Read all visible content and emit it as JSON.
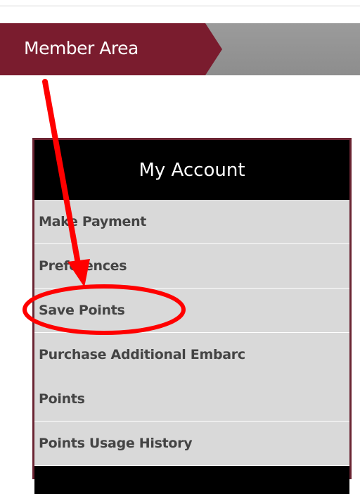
{
  "header": {
    "member_area_label": "Member Area"
  },
  "account_panel": {
    "title": "My Account",
    "items": [
      {
        "label": "Make Payment"
      },
      {
        "label": "Preferences"
      },
      {
        "label": "Save Points"
      },
      {
        "label_line1": "Purchase Additional Embarc",
        "label_line2": "Points"
      },
      {
        "label": "Points Usage History"
      }
    ]
  },
  "annotation": {
    "color": "#ff0000",
    "highlighted_item": "Save Points"
  }
}
